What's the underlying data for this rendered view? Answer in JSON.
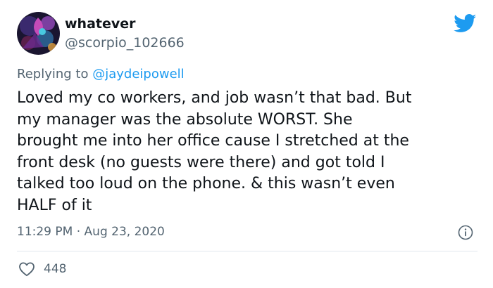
{
  "author": {
    "display_name": "whatever",
    "handle": "@scorpio_102666",
    "avatar_icon": "avatar-image"
  },
  "reply": {
    "prefix": "Replying to",
    "to": "@jaydeipowell"
  },
  "tweet": {
    "lines": [
      "Loved my co workers, and job wasn’t that bad. But",
      "my manager was the absolute WORST. She",
      "brought me into her office cause I stretched at the",
      "front desk (no guests were there) and got told I",
      "talked too loud on the phone. & this wasn’t even",
      "HALF of it"
    ],
    "time": "11:29 PM",
    "separator": "·",
    "date": "Aug 23, 2020"
  },
  "stats": {
    "likes": "448"
  },
  "colors": {
    "brand": "#1d9bf0",
    "secondary_text": "#536471",
    "divider": "#e1e8ed"
  },
  "icons": {
    "logo": "twitter-bird-icon",
    "info": "info-icon",
    "like": "heart-icon"
  }
}
